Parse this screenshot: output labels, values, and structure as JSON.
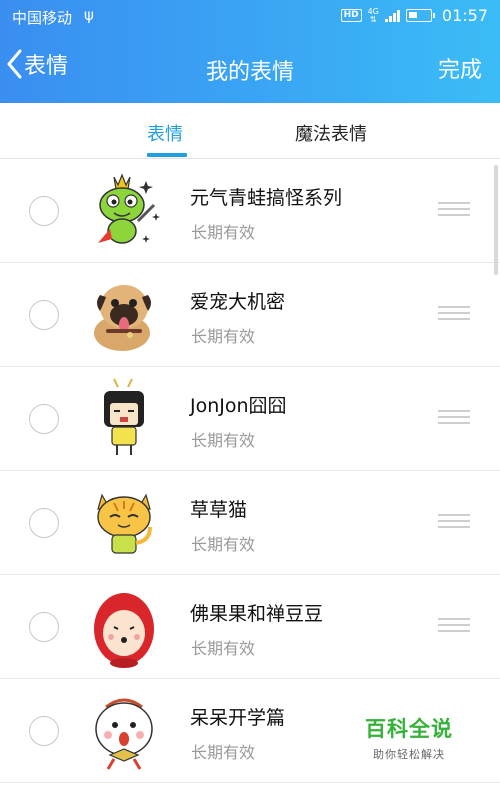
{
  "statusbar": {
    "carrier": "中国移动",
    "usb_icon": "usb-icon",
    "hd": "HD",
    "network": "4G",
    "time": "01:57"
  },
  "navbar": {
    "back_label": "表情",
    "title": "我的表情",
    "done_label": "完成"
  },
  "tabs": [
    {
      "label": "表情",
      "active": true
    },
    {
      "label": "魔法表情",
      "active": false
    }
  ],
  "items": [
    {
      "title": "元气青蛙搞怪系列",
      "status": "长期有效",
      "icon": "frog-sticker-icon"
    },
    {
      "title": "爱宠大机密",
      "status": "长期有效",
      "icon": "pug-dog-sticker-icon"
    },
    {
      "title": "JonJon囧囧",
      "status": "长期有效",
      "icon": "jonjon-sticker-icon"
    },
    {
      "title": "草草猫",
      "status": "长期有效",
      "icon": "cat-sticker-icon"
    },
    {
      "title": "佛果果和禅豆豆",
      "status": "长期有效",
      "icon": "red-hood-sticker-icon"
    },
    {
      "title": "呆呆开学篇",
      "status": "长期有效",
      "icon": "daidai-sticker-icon"
    }
  ],
  "watermark": {
    "main": "百科全说",
    "sub": "助你轻松解决"
  },
  "colors": {
    "header_start": "#3a8ef0",
    "header_end": "#3bbcf6",
    "accent": "#21a0e0",
    "watermark": "#36b23a"
  }
}
